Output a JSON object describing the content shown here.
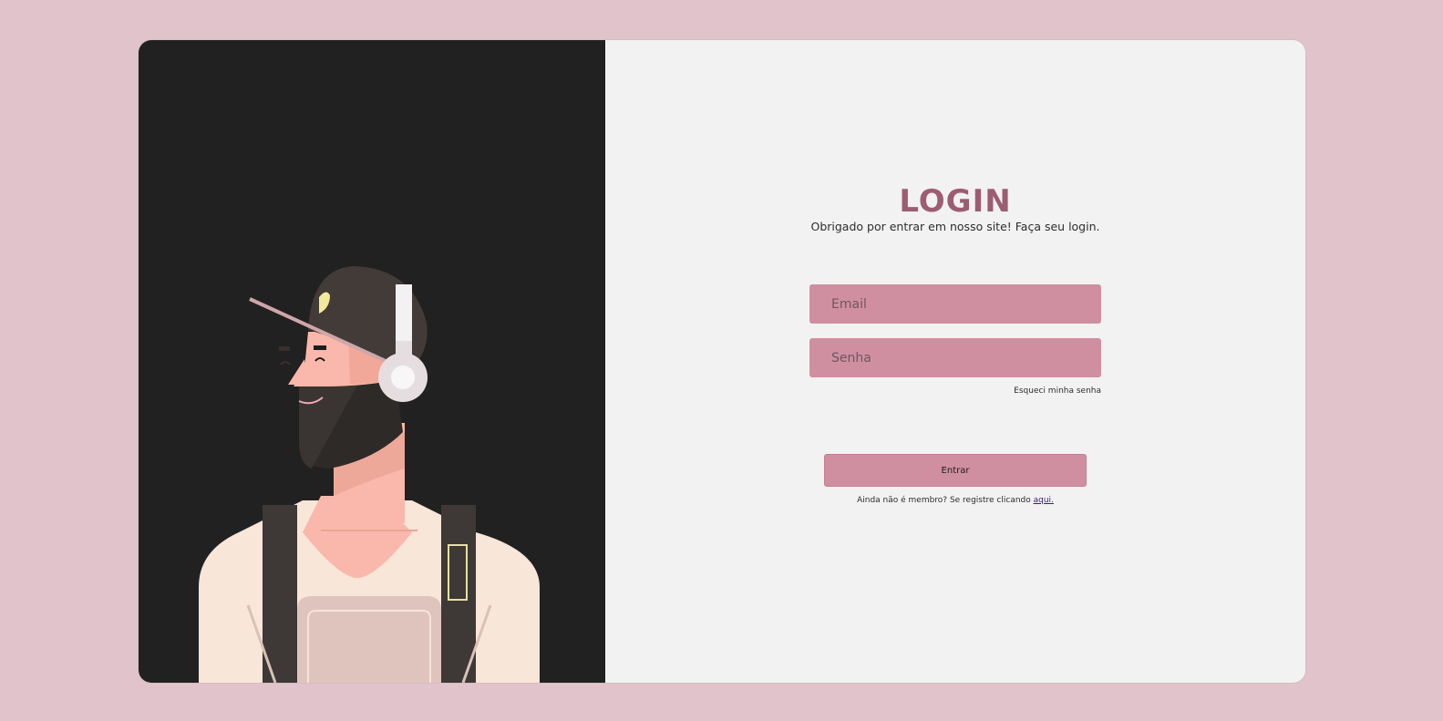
{
  "login": {
    "title": "LOGIN",
    "subtitle": "Obrigado por entrar em nosso site! Faça seu login.",
    "email_placeholder": "Email",
    "password_placeholder": "Senha",
    "forgot_label": "Esqueci minha senha",
    "submit_label": "Entrar",
    "register_prefix": "Ainda não é membro? Se registre clicando ",
    "register_link": "aqui."
  },
  "illustration": {
    "icon": "man-with-headphones-illustration"
  },
  "colors": {
    "page_background": "#e0c3cb",
    "left_panel": "#212121",
    "right_panel": "#f2f2f2",
    "accent": "#d08fa1",
    "title": "#9c5d72"
  }
}
